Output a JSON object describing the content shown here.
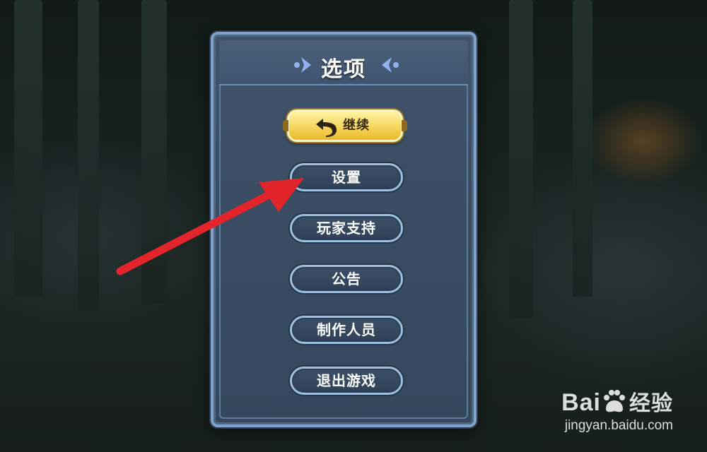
{
  "menu": {
    "title": "选项",
    "continue_label": "继续",
    "items": [
      {
        "label": "设置"
      },
      {
        "label": "玩家支持"
      },
      {
        "label": "公告"
      },
      {
        "label": "制作人员"
      },
      {
        "label": "退出游戏"
      }
    ]
  },
  "watermark": {
    "logo_text": "Bai",
    "logo_suffix": "经验",
    "url": "jingyan.baidu.com"
  },
  "colors": {
    "accent_gold": "#f6d55a",
    "panel_blue": "#3a4d63",
    "border_blue": "#7fa3c9",
    "arrow_red": "#e3242b"
  },
  "icons": {
    "continue": "back-arrow-icon",
    "title_left": "chevron-right-icon",
    "title_right": "chevron-left-icon",
    "watermark": "paw-icon"
  }
}
